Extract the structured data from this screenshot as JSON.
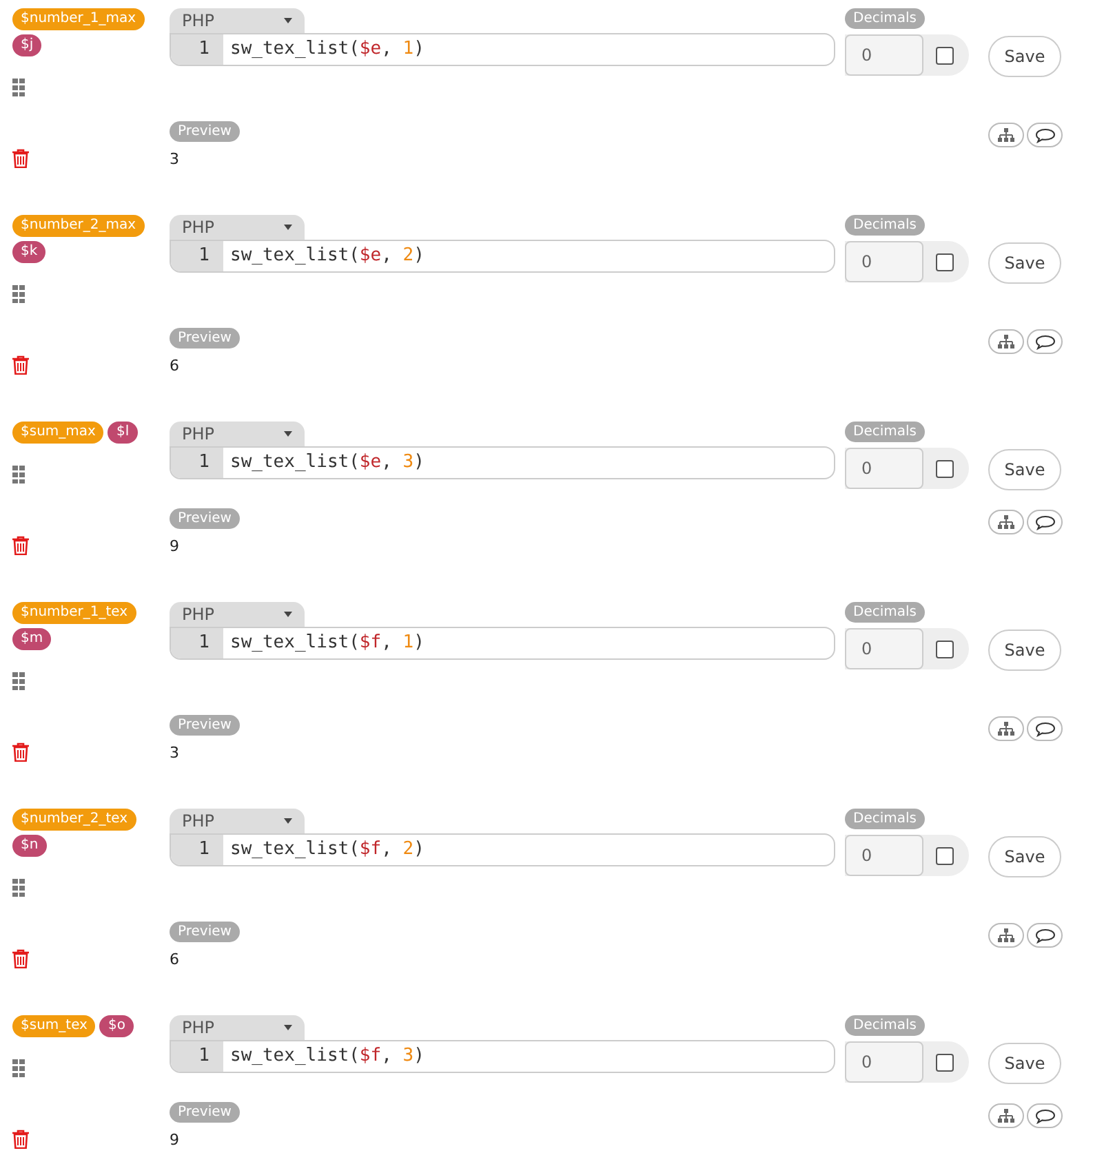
{
  "blocks": [
    {
      "tags": [
        {
          "kind": "name",
          "text": "$number_1_max"
        },
        {
          "kind": "var",
          "text": "$j"
        }
      ],
      "language": "PHP",
      "line_number": "1",
      "code": [
        {
          "kind": "plain",
          "text": "sw_tex_list("
        },
        {
          "kind": "variable",
          "text": "$e"
        },
        {
          "kind": "plain",
          "text": ", "
        },
        {
          "kind": "number",
          "text": "1"
        },
        {
          "kind": "plain",
          "text": ")"
        }
      ],
      "decimals_label": "Decimals",
      "decimals": "0",
      "checked": false,
      "save": "Save",
      "preview_label": "Preview",
      "result": "3"
    },
    {
      "tags": [
        {
          "kind": "name",
          "text": "$number_2_max"
        },
        {
          "kind": "var",
          "text": "$k"
        }
      ],
      "language": "PHP",
      "line_number": "1",
      "code": [
        {
          "kind": "plain",
          "text": "sw_tex_list("
        },
        {
          "kind": "variable",
          "text": "$e"
        },
        {
          "kind": "plain",
          "text": ", "
        },
        {
          "kind": "number",
          "text": "2"
        },
        {
          "kind": "plain",
          "text": ")"
        }
      ],
      "decimals_label": "Decimals",
      "decimals": "0",
      "checked": false,
      "save": "Save",
      "preview_label": "Preview",
      "result": "6"
    },
    {
      "tags": [
        {
          "kind": "name",
          "text": "$sum_max"
        },
        {
          "kind": "var",
          "text": "$l"
        }
      ],
      "language": "PHP",
      "line_number": "1",
      "code": [
        {
          "kind": "plain",
          "text": "sw_tex_list("
        },
        {
          "kind": "variable",
          "text": "$e"
        },
        {
          "kind": "plain",
          "text": ", "
        },
        {
          "kind": "number",
          "text": "3"
        },
        {
          "kind": "plain",
          "text": ")"
        }
      ],
      "decimals_label": "Decimals",
      "decimals": "0",
      "checked": false,
      "save": "Save",
      "preview_label": "Preview",
      "result": "9"
    },
    {
      "tags": [
        {
          "kind": "name",
          "text": "$number_1_tex"
        },
        {
          "kind": "var",
          "text": "$m"
        }
      ],
      "language": "PHP",
      "line_number": "1",
      "code": [
        {
          "kind": "plain",
          "text": "sw_tex_list("
        },
        {
          "kind": "variable",
          "text": "$f"
        },
        {
          "kind": "plain",
          "text": ", "
        },
        {
          "kind": "number",
          "text": "1"
        },
        {
          "kind": "plain",
          "text": ")"
        }
      ],
      "decimals_label": "Decimals",
      "decimals": "0",
      "checked": false,
      "save": "Save",
      "preview_label": "Preview",
      "result": "3"
    },
    {
      "tags": [
        {
          "kind": "name",
          "text": "$number_2_tex"
        },
        {
          "kind": "var",
          "text": "$n"
        }
      ],
      "language": "PHP",
      "line_number": "1",
      "code": [
        {
          "kind": "plain",
          "text": "sw_tex_list("
        },
        {
          "kind": "variable",
          "text": "$f"
        },
        {
          "kind": "plain",
          "text": ", "
        },
        {
          "kind": "number",
          "text": "2"
        },
        {
          "kind": "plain",
          "text": ")"
        }
      ],
      "decimals_label": "Decimals",
      "decimals": "0",
      "checked": false,
      "save": "Save",
      "preview_label": "Preview",
      "result": "6"
    },
    {
      "tags": [
        {
          "kind": "name",
          "text": "$sum_tex"
        },
        {
          "kind": "var",
          "text": "$o"
        }
      ],
      "language": "PHP",
      "line_number": "1",
      "code": [
        {
          "kind": "plain",
          "text": "sw_tex_list("
        },
        {
          "kind": "variable",
          "text": "$f"
        },
        {
          "kind": "plain",
          "text": ", "
        },
        {
          "kind": "number",
          "text": "3"
        },
        {
          "kind": "plain",
          "text": ")"
        }
      ],
      "decimals_label": "Decimals",
      "decimals": "0",
      "checked": false,
      "save": "Save",
      "preview_label": "Preview",
      "result": "9"
    }
  ]
}
